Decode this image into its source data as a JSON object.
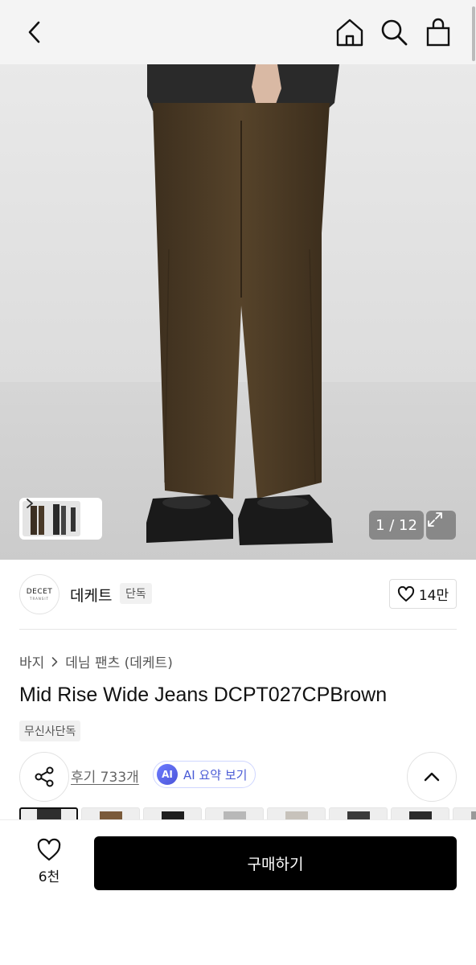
{
  "gallery": {
    "counter": "1 / 12"
  },
  "brand": {
    "logo_text": "DECET",
    "logo_subtext": "TRANSIT",
    "name": "데케트",
    "badge": "단독",
    "like_count": "14만"
  },
  "breadcrumb": {
    "category": "바지",
    "subcategory": "데님 팬츠 (데케트)"
  },
  "product": {
    "title": "Mid Rise Wide Jeans DCPT027CPBrown",
    "tag": "무신사단독"
  },
  "actions": {
    "reviews": "후기 733개",
    "ai_icon": "AI",
    "ai_summary": "AI 요약 보기"
  },
  "bottom": {
    "wish_count": "6천",
    "buy_label": "구매하기"
  },
  "colors": {
    "accent": "#000000",
    "ai_accent": "#4a5bd6",
    "pants_brown": "#4a3a24"
  }
}
